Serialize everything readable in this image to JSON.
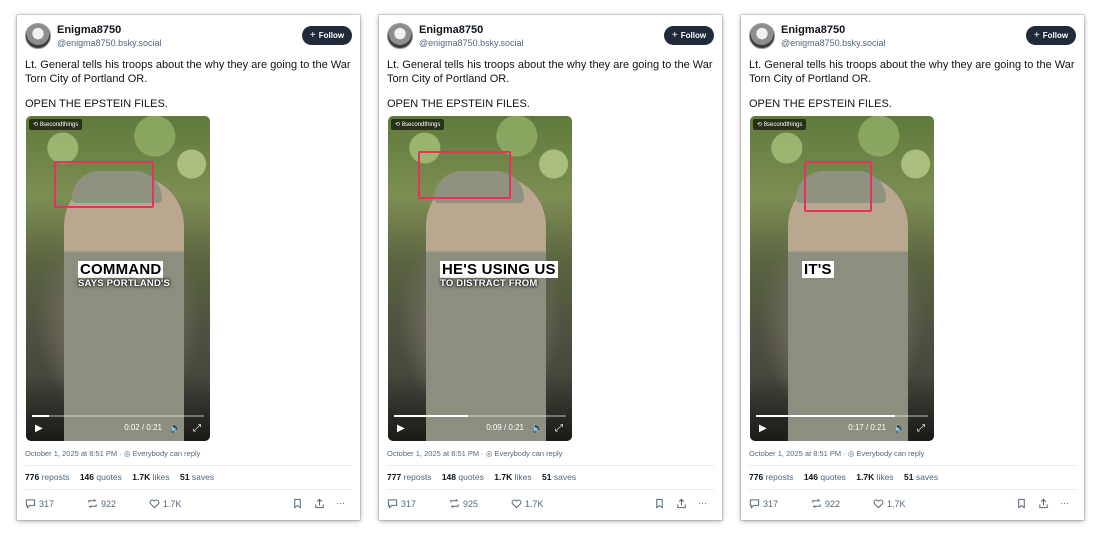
{
  "posts": [
    {
      "user": {
        "name": "Enigma8750",
        "handle": "@enigma8750.bsky.social"
      },
      "follow_label": "Follow",
      "text": "Lt. General tells his troops about the why they are going to the War Torn City of Portland OR.",
      "text2": "OPEN THE EPSTEIN FILES.",
      "video": {
        "tag": "8secondthings",
        "caption_big": "COMMAND",
        "caption_small": "SAYS PORTLAND'S",
        "time": "0:02 / 0:21",
        "progress": 0.1
      },
      "date": "October 1, 2025 at 8:51 PM",
      "reply_setting": "Everybody can reply",
      "stats": {
        "reposts": "776",
        "reposts_label": "reposts",
        "quotes": "146",
        "quotes_label": "quotes",
        "likes": "1.7K",
        "likes_label": "likes",
        "saves": "51",
        "saves_label": "saves"
      },
      "counts": {
        "replies": "317",
        "reposts": "922",
        "likes": "1.7K"
      }
    },
    {
      "user": {
        "name": "Enigma8750",
        "handle": "@enigma8750.bsky.social"
      },
      "follow_label": "Follow",
      "text": "Lt. General tells his troops about the why they are going to the War Torn City of Portland OR.",
      "text2": "OPEN THE EPSTEIN FILES.",
      "video": {
        "tag": "8secondthings",
        "caption_big": "HE'S USING US",
        "caption_small": "TO DISTRACT FROM",
        "time": "0:09 / 0:21",
        "progress": 0.43
      },
      "date": "October 1, 2025 at 8:51 PM",
      "reply_setting": "Everybody can reply",
      "stats": {
        "reposts": "777",
        "reposts_label": "reposts",
        "quotes": "148",
        "quotes_label": "quotes",
        "likes": "1.7K",
        "likes_label": "likes",
        "saves": "51",
        "saves_label": "saves"
      },
      "counts": {
        "replies": "317",
        "reposts": "925",
        "likes": "1.7K"
      }
    },
    {
      "user": {
        "name": "Enigma8750",
        "handle": "@enigma8750.bsky.social"
      },
      "follow_label": "Follow",
      "text": "Lt. General tells his troops about the why they are going to the War Torn City of Portland OR.",
      "text2": "OPEN THE EPSTEIN FILES.",
      "video": {
        "tag": "8secondthings",
        "caption_big": "IT'S",
        "caption_small": "",
        "time": "0:17 / 0:21",
        "progress": 0.81
      },
      "date": "October 1, 2025 at 8:51 PM",
      "reply_setting": "Everybody can reply",
      "stats": {
        "reposts": "776",
        "reposts_label": "reposts",
        "quotes": "146",
        "quotes_label": "quotes",
        "likes": "1.7K",
        "likes_label": "likes",
        "saves": "51",
        "saves_label": "saves"
      },
      "counts": {
        "replies": "317",
        "reposts": "922",
        "likes": "1.7K"
      }
    }
  ],
  "icons": [
    "play-icon",
    "volume-icon",
    "fullscreen-icon",
    "reply-icon",
    "repost-icon",
    "like-icon",
    "bookmark-icon",
    "share-icon",
    "more-icon",
    "globe-icon",
    "repost-tag-icon"
  ],
  "colors": {
    "follow_bg": "#202a38",
    "highlight": "#e5335e",
    "muted": "#53677b"
  }
}
